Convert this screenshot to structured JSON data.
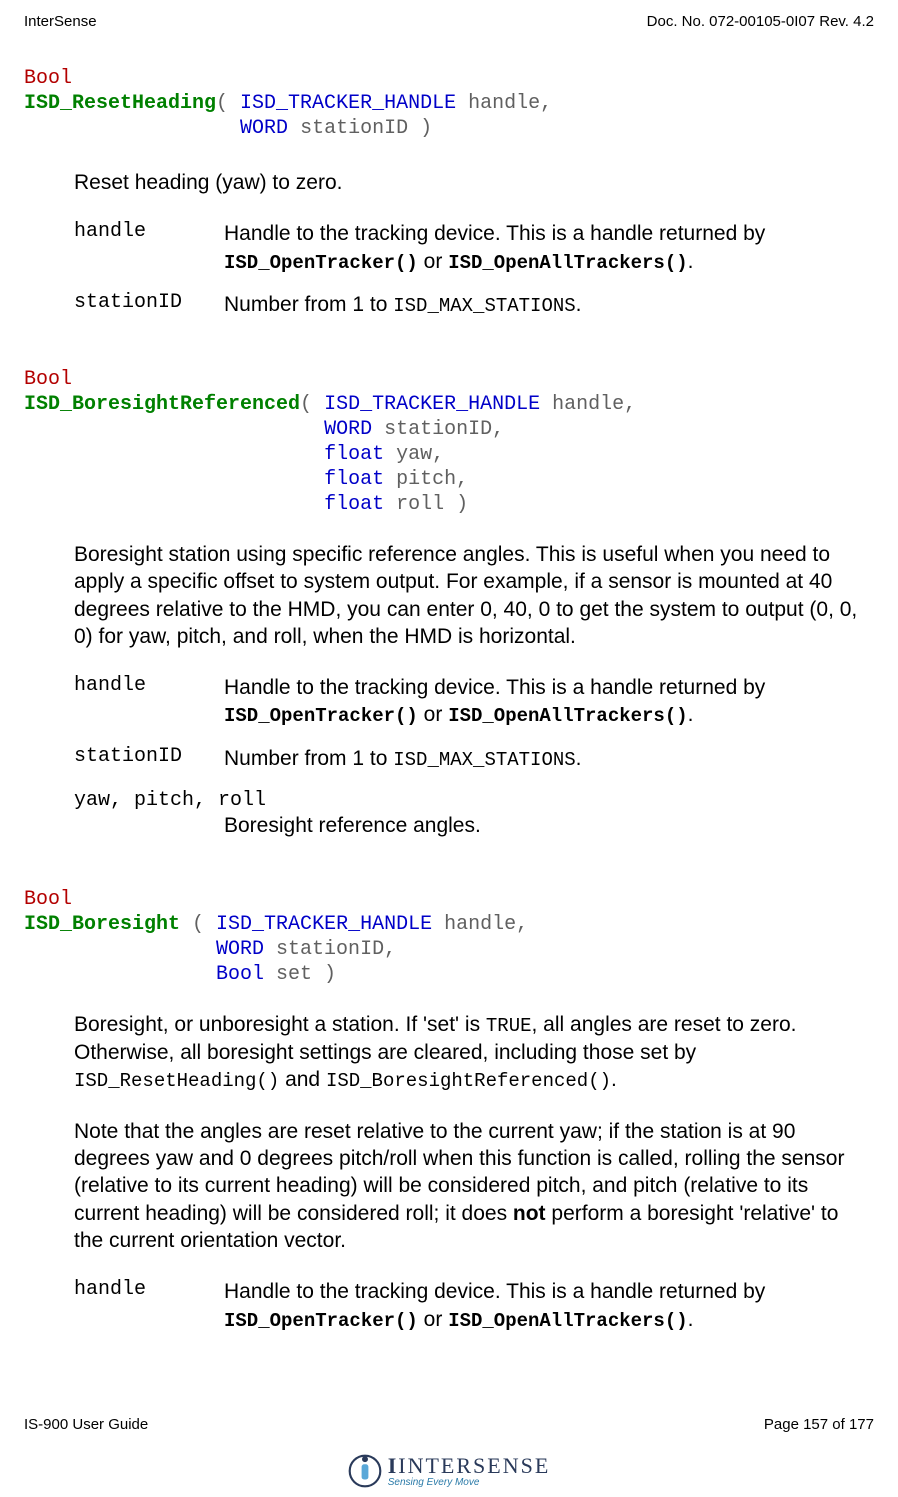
{
  "header": {
    "left": "InterSense",
    "right": "Doc. No. 072-00105-0I07 Rev. 4.2"
  },
  "footer": {
    "left": "IS-900 User Guide",
    "right": "Page 157 of 177"
  },
  "logo": {
    "name": "INTERSENSE",
    "tagline": "Sensing Every Move"
  },
  "fn1": {
    "ret": "Bool",
    "name": "ISD_ResetHeading",
    "sig_line1a": "( ",
    "sig_line1_t": "ISD_TRACKER_HANDLE",
    "sig_line1b": " handle,",
    "sig_line2_pad": "                  ",
    "sig_line2_t": "WORD",
    "sig_line2b": " stationID )",
    "desc": "Reset heading (yaw) to zero.",
    "p_handle": "handle",
    "p_handle_pre": "Handle to the tracking device.  This is a handle returned by ",
    "p_handle_m1": "ISD_OpenTracker()",
    "p_handle_mid": " or ",
    "p_handle_m2": "ISD_OpenAllTrackers()",
    "p_handle_post": ".",
    "p_station": "stationID",
    "p_station_pre": "Number from 1 to ",
    "p_station_m": "ISD_MAX_STATIONS",
    "p_station_post": "."
  },
  "fn2": {
    "ret": "Bool",
    "name": "ISD_BoresightReferenced",
    "padA": "                         ",
    "l1a": "( ",
    "l1t": "ISD_TRACKER_HANDLE",
    "l1b": " handle,",
    "l2t": "WORD",
    "l2b": " stationID,",
    "l3t": "float",
    "l3b": " yaw,",
    "l4t": "float",
    "l4b": " pitch,",
    "l5t": "float",
    "l5b": " roll )",
    "desc": "Boresight station using specific reference angles.  This is useful when you need to apply a specific offset to system output.  For example, if a sensor is mounted at 40 degrees relative to the HMD, you can enter 0, 40, 0 to get the system to output (0, 0, 0) for yaw, pitch, and roll, when the HMD is horizontal.",
    "p_handle": "handle",
    "p_handle_pre": "Handle to the tracking device.  This is a handle returned by ",
    "p_handle_m1": "ISD_OpenTracker()",
    "p_handle_mid": " or ",
    "p_handle_m2": "ISD_OpenAllTrackers()",
    "p_handle_post": ".",
    "p_station": "stationID",
    "p_station_pre": "Number from 1 to ",
    "p_station_m": "ISD_MAX_STATIONS",
    "p_station_post": ".",
    "p_ypr": "yaw, pitch, roll",
    "p_ypr_desc": "Boresight reference angles."
  },
  "fn3": {
    "ret": "Bool",
    "name": "ISD_Boresight",
    "padA": "                ",
    "l1a": " ( ",
    "l1t": "ISD_TRACKER_HANDLE",
    "l1b": " handle,",
    "l2t": "WORD",
    "l2b": " stationID,",
    "l3t": "Bool",
    "l3b": " set )",
    "desc1_pre": "Boresight, or unboresight a station.  If 'set' is ",
    "desc1_m1": "TRUE",
    "desc1_mid": ", all angles are reset to zero.  Otherwise, all boresight settings are cleared, including those set by ",
    "desc1_m2": "ISD_ResetHeading()",
    "desc1_and": " and ",
    "desc1_m3": "ISD_BoresightReferenced()",
    "desc1_post": ".",
    "desc2_a": "Note that the angles are reset relative to the current yaw; if the station is at 90 degrees yaw and 0 degrees pitch/roll when this function is called, rolling the sensor (relative to its current heading) will be considered pitch, and pitch (relative to its current heading) will be considered roll; it does ",
    "desc2_not": "not",
    "desc2_b": " perform a boresight 'relative' to the current orientation vector.",
    "p_handle": "handle",
    "p_handle_pre": "Handle to the tracking device.  This is a handle returned by ",
    "p_handle_m1": "ISD_OpenTracker()",
    "p_handle_mid": " or ",
    "p_handle_m2": "ISD_OpenAllTrackers()",
    "p_handle_post": "."
  }
}
